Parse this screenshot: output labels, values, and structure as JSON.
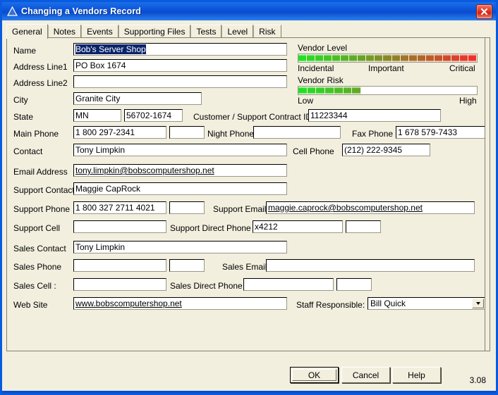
{
  "window": {
    "title": "Changing a Vendors Record",
    "icon": "triangle-icon",
    "close_label": "✕"
  },
  "tabs": [
    {
      "label": "General",
      "active": true
    },
    {
      "label": "Notes",
      "active": false
    },
    {
      "label": "Events",
      "active": false
    },
    {
      "label": "Supporting Files",
      "active": false
    },
    {
      "label": "Tests",
      "active": false
    },
    {
      "label": "Level",
      "active": false
    },
    {
      "label": "Risk",
      "active": false
    }
  ],
  "form": {
    "name": {
      "label": "Name",
      "value": "Bob's Server Shop",
      "selected": true
    },
    "address1": {
      "label": "Address Line1",
      "value": "PO Box 1674"
    },
    "address2": {
      "label": "Address Line2",
      "value": ""
    },
    "city": {
      "label": "City",
      "value": "Granite City"
    },
    "state": {
      "label": "State",
      "value": "MN"
    },
    "zip": {
      "value": "56702-1674"
    },
    "contract_id": {
      "label": "Customer / Support Contract ID :",
      "value": "11223344"
    },
    "main_phone": {
      "label": "Main Phone",
      "value": "1 800 297-2341"
    },
    "main_phone_ext": {
      "value": ""
    },
    "night_phone": {
      "label": "Night Phone",
      "value": ""
    },
    "fax_phone": {
      "label": "Fax Phone",
      "value": "1 678 579-7433"
    },
    "contact": {
      "label": "Contact",
      "value": "Tony Limpkin"
    },
    "cell_phone": {
      "label": "Cell Phone",
      "value": "(212) 222-9345"
    },
    "email": {
      "label": "Email Address",
      "value": "tony.limpkin@bobscomputershop.net"
    },
    "support_contact": {
      "label": "Support Contact",
      "value": "Maggie CapRock"
    },
    "support_phone": {
      "label": "Support Phone",
      "value": "1 800 327 2711 4021"
    },
    "support_phone_ext": {
      "value": ""
    },
    "support_email": {
      "label": "Support Email",
      "value": "maggie.caprock@bobscomputershop.net"
    },
    "support_cell": {
      "label": "Support Cell",
      "value": ""
    },
    "support_direct_phone": {
      "label": "Support Direct Phone",
      "value": "x4212"
    },
    "support_direct_ext": {
      "value": ""
    },
    "sales_contact": {
      "label": "Sales Contact",
      "value": "Tony Limpkin"
    },
    "sales_phone": {
      "label": "Sales Phone",
      "value": ""
    },
    "sales_phone_ext": {
      "value": ""
    },
    "sales_email": {
      "label": "Sales Email",
      "value": ""
    },
    "sales_cell": {
      "label": "Sales Cell :",
      "value": ""
    },
    "sales_direct_phone": {
      "label": "Sales Direct Phone",
      "value": ""
    },
    "sales_direct_ext": {
      "value": ""
    },
    "website": {
      "label": "Web Site",
      "value": "www.bobscomputershop.net"
    },
    "staff_responsible": {
      "label": "Staff Responsible:",
      "value": "Bill Quick"
    }
  },
  "gauges": {
    "vendor_level": {
      "title": "Vendor Level",
      "min_label": "Incidental",
      "mid_label": "Important",
      "max_label": "Critical",
      "segments": 21,
      "filled": 21,
      "start_color": "#22e022",
      "end_color": "#f03028"
    },
    "vendor_risk": {
      "title": "Vendor Risk",
      "min_label": "Low",
      "max_label": "High",
      "segments": 21,
      "filled": 7,
      "start_color": "#22e022",
      "end_color": "#f03028"
    }
  },
  "buttons": {
    "ok": "OK",
    "cancel": "Cancel",
    "help": "Help"
  },
  "version": "3.08"
}
